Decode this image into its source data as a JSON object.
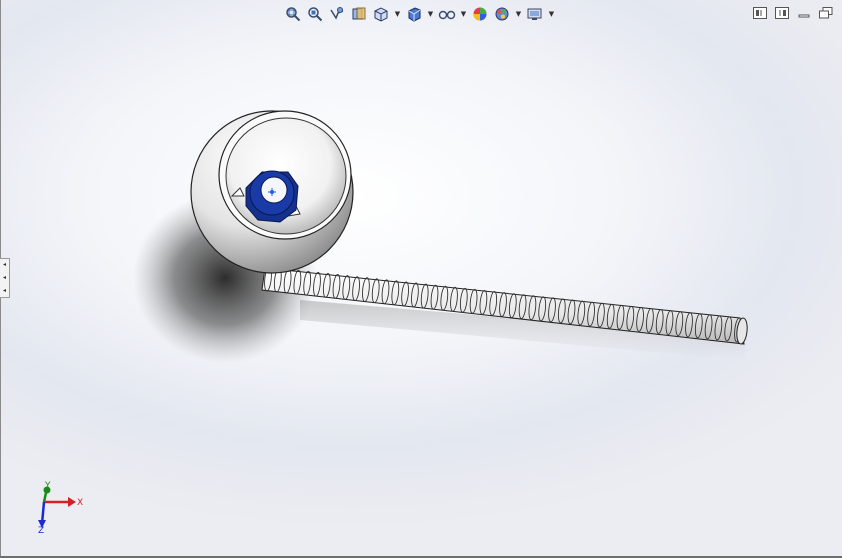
{
  "toolbar": {
    "items": [
      {
        "icon": "zoom-to-fit-icon"
      },
      {
        "icon": "zoom-to-area-icon"
      },
      {
        "icon": "previous-view-icon"
      },
      {
        "icon": "section-view-icon"
      },
      {
        "icon": "view-orientation-icon",
        "dropdown": true
      },
      {
        "icon": "display-style-icon",
        "dropdown": true
      },
      {
        "icon": "hide-show-items-icon",
        "dropdown": true
      },
      {
        "icon": "edit-appearance-icon"
      },
      {
        "icon": "apply-scene-icon",
        "dropdown": true
      },
      {
        "icon": "view-settings-icon",
        "dropdown": true
      }
    ]
  },
  "window_controls": [
    "tile-left-icon",
    "tile-right-icon",
    "minimize-icon",
    "restore-icon"
  ],
  "triad": {
    "x": "X",
    "y": "Y",
    "z": "Z"
  },
  "colors": {
    "part_blue": "#1a3aa8",
    "axis_x": "#d42020",
    "axis_y": "#1a8a1a",
    "axis_z": "#1a2ad4"
  }
}
